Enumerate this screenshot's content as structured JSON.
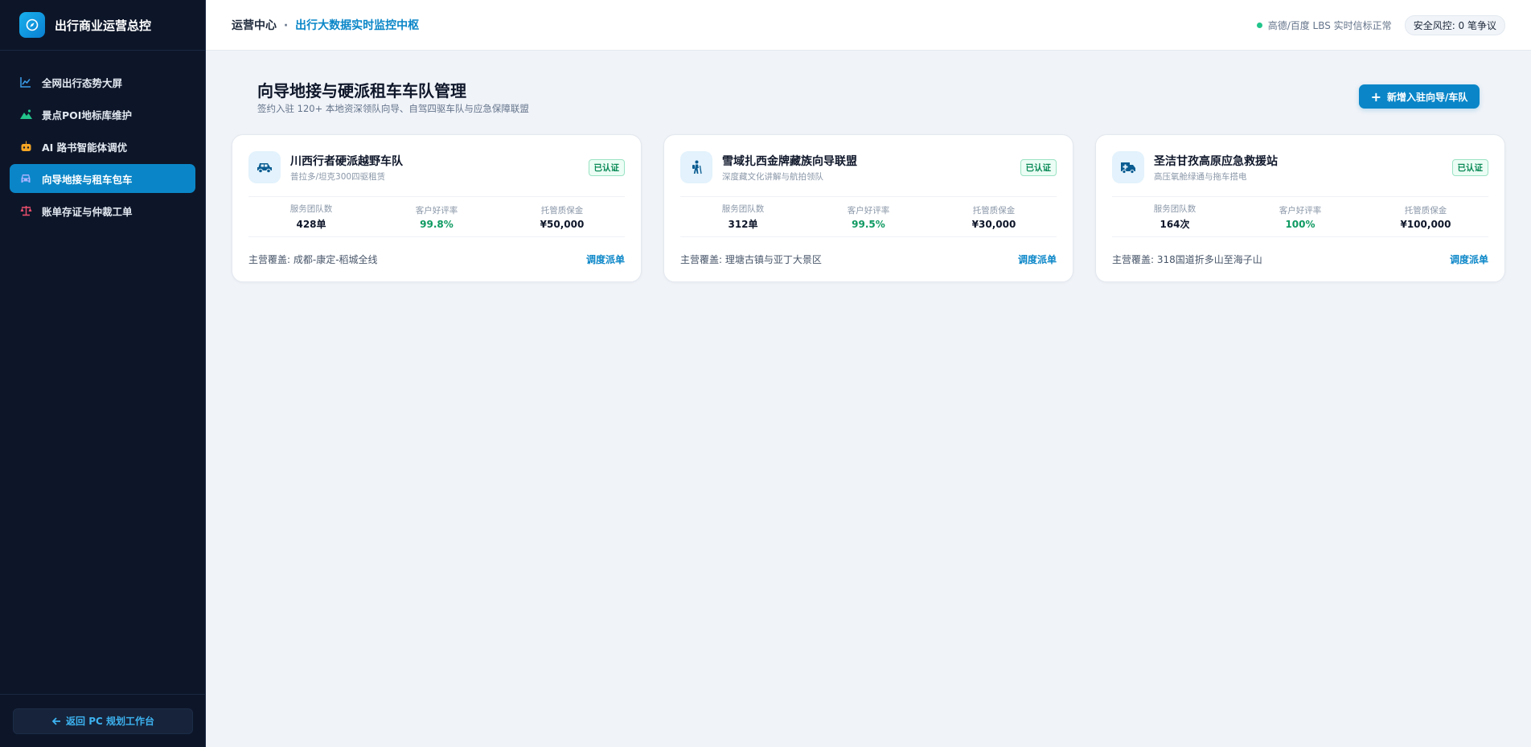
{
  "app": {
    "title": "出行商业运营总控"
  },
  "sidebar": {
    "items": [
      {
        "label": "全网出行态势大屏",
        "icon": "chart-line-icon",
        "color": "#3b9eea"
      },
      {
        "label": "景点POI地标库维护",
        "icon": "mountain-icon",
        "color": "#22c58b"
      },
      {
        "label": "AI 路书智能体调优",
        "icon": "robot-icon",
        "color": "#f5a524"
      },
      {
        "label": "向导地接与租车包车",
        "icon": "car-icon",
        "color": "#6d7cf2",
        "active": true
      },
      {
        "label": "账单存证与仲裁工单",
        "icon": "scale-icon",
        "color": "#f0506e"
      }
    ],
    "footer_button": "返回 PC 规划工作台"
  },
  "header": {
    "crumb_root": "运营中心",
    "crumb_sep": "·",
    "crumb_current": "出行大数据实时监控中枢",
    "signal_status": "高德/百度 LBS 实时信标正常",
    "risk_label": "安全风控: 0 笔争议"
  },
  "page": {
    "title": "向导地接与硬派租车车队管理",
    "subtitle": "签约入驻 120+ 本地资深领队向导、自驾四驱车队与应急保障联盟",
    "add_button": "新增入驻向导/车队"
  },
  "cards": [
    {
      "name": "川西行者硬派越野车队",
      "desc": "普拉多/坦克300四驱租赁",
      "badge": "已认证",
      "icon": "offroad-car-icon",
      "stats": [
        {
          "label": "服务团队数",
          "value": "428单"
        },
        {
          "label": "客户好评率",
          "value": "99.8%"
        },
        {
          "label": "托管质保金",
          "value": "¥50,000"
        }
      ],
      "coverage": "主营覆盖: 成都-康定-稻城全线",
      "action": "调度派单"
    },
    {
      "name": "雪域扎西金牌藏族向导联盟",
      "desc": "深度藏文化讲解与航拍领队",
      "badge": "已认证",
      "icon": "hiker-icon",
      "stats": [
        {
          "label": "服务团队数",
          "value": "312单"
        },
        {
          "label": "客户好评率",
          "value": "99.5%"
        },
        {
          "label": "托管质保金",
          "value": "¥30,000"
        }
      ],
      "coverage": "主营覆盖: 理塘古镇与亚丁大景区",
      "action": "调度派单"
    },
    {
      "name": "圣洁甘孜高原应急救援站",
      "desc": "高压氧舱绿通与拖车搭电",
      "badge": "已认证",
      "icon": "ambulance-icon",
      "stats": [
        {
          "label": "服务团队数",
          "value": "164次"
        },
        {
          "label": "客户好评率",
          "value": "100%"
        },
        {
          "label": "托管质保金",
          "value": "¥100,000"
        }
      ],
      "coverage": "主营覆盖: 318国道折多山至海子山",
      "action": "调度派单"
    }
  ]
}
